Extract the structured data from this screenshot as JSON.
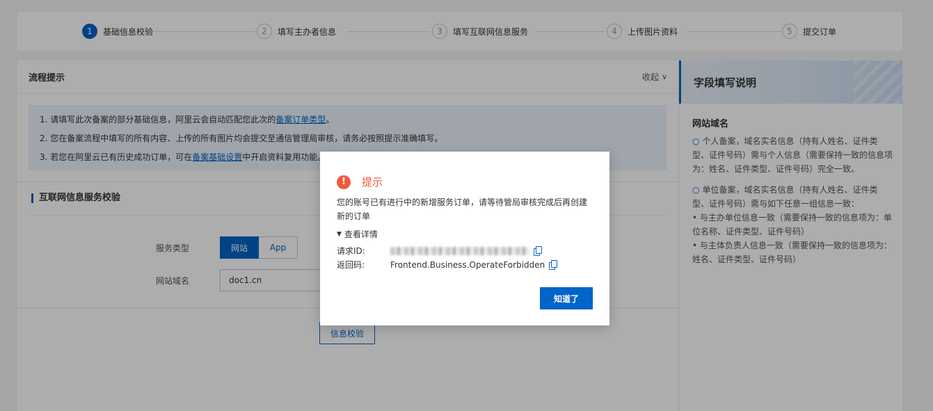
{
  "stepper": {
    "steps": [
      {
        "num": "1",
        "label": "基础信息校验"
      },
      {
        "num": "2",
        "label": "填写主办者信息"
      },
      {
        "num": "3",
        "label": "填写互联网信息服务"
      },
      {
        "num": "4",
        "label": "上传图片资料"
      },
      {
        "num": "5",
        "label": "提交订单"
      }
    ]
  },
  "flow": {
    "title": "流程提示",
    "collapse_label": "收起",
    "notices": [
      {
        "pre": "1. 请填写此次备案的部分基础信息，阿里云会自动匹配您此次的",
        "link": "备案订单类型",
        "post": "。"
      },
      {
        "pre": "2. 您在备案流程中填写的所有内容、上传的所有图片均会提交至通信管理局审核，请务必按照提示准确填写。",
        "link": "",
        "post": ""
      },
      {
        "pre": "3. 若您在阿里云已有历史成功订单，可在",
        "link": "备案基础设置",
        "post": "中开启资料复用功能。"
      }
    ]
  },
  "form": {
    "section_title": "互联网信息服务校验",
    "service_type_label": "服务类型",
    "service_type_options": [
      "网站",
      "App"
    ],
    "domain_label": "网站域名",
    "domain_value": "doc1.cn",
    "verify_button": "信息校验"
  },
  "side": {
    "title": "字段填写说明",
    "subtitle": "网站域名",
    "para1": "个人备案，域名实名信息（持有人姓名、证件类型、证件号码）需与个人信息（需要保持一致的信息项为：姓名、证件类型、证件号码）完全一致。",
    "para2": "单位备案，域名实名信息（持有人姓名、证件类型、证件号码）需与如下任意一组信息一致：",
    "bullet1": "• 与主办单位信息一致（需要保持一致的信息项为：单位名称、证件类型、证件号码）",
    "bullet2": "• 与主体负责人信息一致（需要保持一致的信息项为：姓名、证件类型、证件号码）"
  },
  "dialog": {
    "title": "提示",
    "message": "您的账号已有进行中的新增服务订单，请等待管局审核完成后再创建新的订单",
    "details_toggle": "查看详情",
    "request_id_label": "请求ID:",
    "return_code_label": "返回码:",
    "return_code_value": "Frontend.Business.OperateForbidden",
    "ok_button": "知道了"
  },
  "colors": {
    "primary": "#0064c8",
    "warning": "#f05a3c"
  }
}
